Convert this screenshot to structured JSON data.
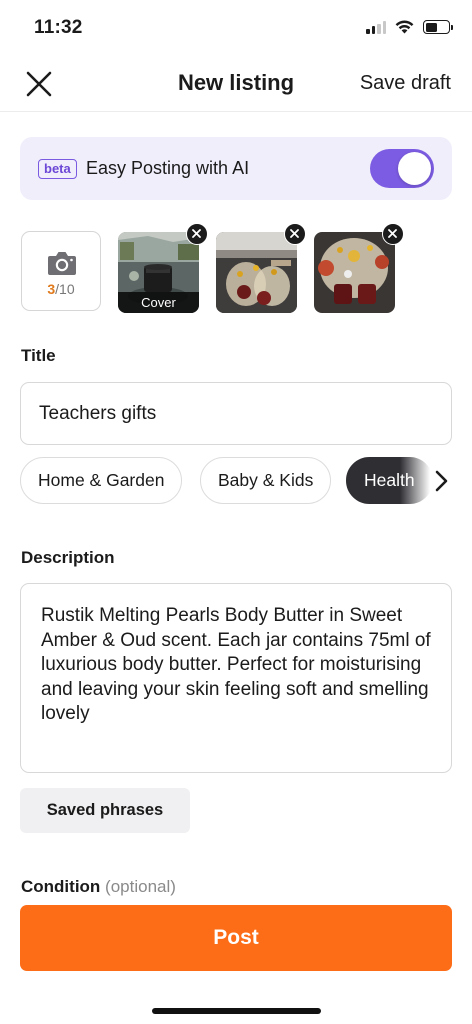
{
  "status_bar": {
    "time": "11:32"
  },
  "header": {
    "title": "New listing",
    "save_draft": "Save draft"
  },
  "ai_banner": {
    "badge": "beta",
    "label": "Easy Posting with AI",
    "enabled": true,
    "toggle_color": "#7c5ce2"
  },
  "photos": {
    "count_current": "3",
    "count_total": "/10",
    "cover_label": "Cover",
    "items": [
      {
        "icon": "photo-candle-jar"
      },
      {
        "icon": "photo-gift-jars"
      },
      {
        "icon": "photo-gift-closeup"
      }
    ]
  },
  "title_section": {
    "label": "Title",
    "value": "Teachers gifts"
  },
  "categories": [
    {
      "label": "Home & Garden",
      "selected": false
    },
    {
      "label": "Baby & Kids",
      "selected": false
    },
    {
      "label": "Health",
      "selected": true
    }
  ],
  "description_section": {
    "label": "Description",
    "value": "Rustik Melting Pearls Body Butter in Sweet Amber & Oud scent. Each jar contains 75ml of luxurious body butter. Perfect for moisturising and leaving your skin feeling soft and smelling lovely"
  },
  "saved_phrases_label": "Saved phrases",
  "condition_section": {
    "label": "Condition",
    "optional": "(optional)"
  },
  "post_button": {
    "label": "Post",
    "color": "#fd6d17"
  }
}
